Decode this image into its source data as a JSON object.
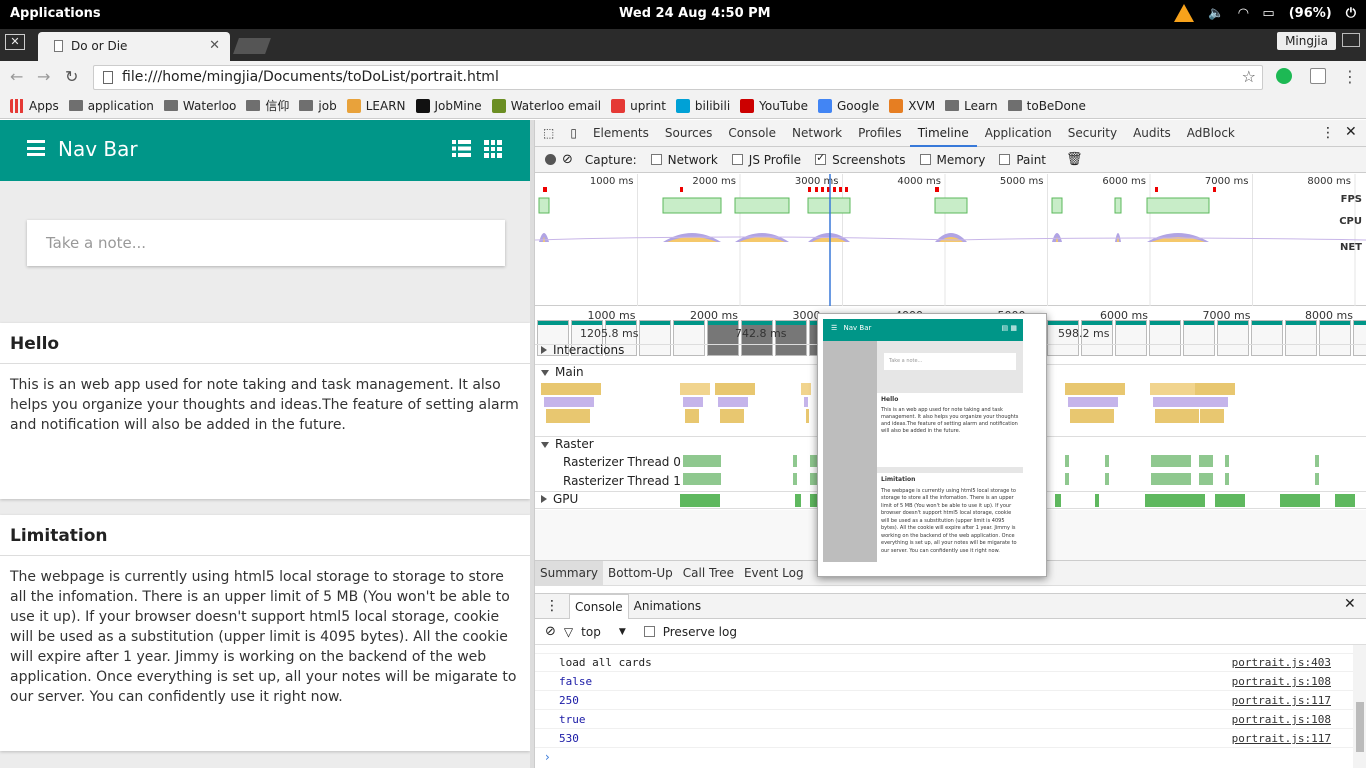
{
  "system": {
    "apps_label": "Applications",
    "clock": "Wed 24 Aug   4:50 PM",
    "battery": "(96%)"
  },
  "browser": {
    "tab_title": "Do or Die",
    "url": "file:///home/mingjia/Documents/toDoList/portrait.html",
    "profile": "Mingjia",
    "bookmarks": [
      "Apps",
      "application",
      "Waterloo",
      "信仰",
      "job",
      "LEARN",
      "JobMine",
      "Waterloo email",
      "uprint",
      "bilibili",
      "YouTube",
      "Google",
      "XVM",
      "Learn",
      "toBeDone"
    ]
  },
  "page": {
    "nav_title": "Nav Bar",
    "note_placeholder": "Take a note...",
    "cards": [
      {
        "title": "Hello",
        "body": "This is an web app used for note taking and task management. It also helps you organize your thoughts and ideas.The feature of setting alarm and notification will also be added in the future."
      },
      {
        "title": "Limitation",
        "body": "The webpage is currently using html5 local storage to storage to store all the infomation. There is an upper limit of 5 MB (You won't be able to use it up). If your browser doesn't support html5 local storage, cookie will be used as a substitution (upper limit is 4095 bytes). All the cookie will expire after 1 year. Jimmy is working on the backend of the web application. Once everything is set up, all your notes will be migarate to our server. You can confidently use it right now."
      }
    ]
  },
  "devtools": {
    "tabs": [
      "Elements",
      "Sources",
      "Console",
      "Network",
      "Profiles",
      "Timeline",
      "Application",
      "Security",
      "Audits",
      "AdBlock"
    ],
    "active_tab": "Timeline",
    "capture_label": "Capture:",
    "capture_options": [
      {
        "label": "Network",
        "checked": false
      },
      {
        "label": "JS Profile",
        "checked": false
      },
      {
        "label": "Screenshots",
        "checked": true
      },
      {
        "label": "Memory",
        "checked": false
      },
      {
        "label": "Paint",
        "checked": false
      }
    ],
    "overview_ticks": [
      "1000 ms",
      "2000 ms",
      "3000 ms",
      "4000 ms",
      "5000 ms",
      "6000 ms",
      "7000 ms",
      "8000 ms"
    ],
    "overview_labels": [
      "FPS",
      "CPU",
      "NET"
    ],
    "ruler_ticks": [
      "1000 ms",
      "2000 ms",
      "3000 ms",
      "4000 ms",
      "5000 ms",
      "6000 ms",
      "7000 ms",
      "8000 ms"
    ],
    "frame_times": [
      "1205.8 ms",
      "742.8 ms",
      "598.2 ms"
    ],
    "sections": {
      "interactions": "Interactions",
      "main": "Main",
      "raster": "Raster",
      "raster0": "Rasterizer Thread 0",
      "raster1": "Rasterizer Thread 1",
      "gpu": "GPU"
    },
    "bottom_tabs": [
      "Summary",
      "Bottom-Up",
      "Call Tree",
      "Event Log"
    ],
    "popup": {
      "nav_title": "Nav Bar",
      "placeholder": "Take a note...",
      "card1_title": "Hello",
      "card1_body": "This is an web app used for note taking and task management. It also helps you organize your thoughts and ideas.The feature of setting alarm and notification will also be added in the future.",
      "card2_title": "Limitation",
      "card2_body": "The webpage is currently using html5 local storage to storage to store all the infomation. There is an upper limit of 5 MB (You won't be able to use it up). If your browser doesn't support html5 local storage, cookie will be used as a substitution (upper limit is 4095 bytes). All the cookie will expire after 1 year. Jimmy is working on the backend of the web application. Once everything is set up, all your notes will be migarate to our server. You can confidently use it right now."
    },
    "console_tabs": [
      "Console",
      "Animations"
    ],
    "context": "top",
    "preserve_log": "Preserve log",
    "logs": [
      {
        "msg": "load all cards",
        "src": "portrait.js:403",
        "kw": false
      },
      {
        "msg": "false",
        "src": "portrait.js:108",
        "kw": true
      },
      {
        "msg": "250",
        "src": "portrait.js:117",
        "kw": true
      },
      {
        "msg": "true",
        "src": "portrait.js:108",
        "kw": true
      },
      {
        "msg": "530",
        "src": "portrait.js:117",
        "kw": true
      }
    ]
  }
}
